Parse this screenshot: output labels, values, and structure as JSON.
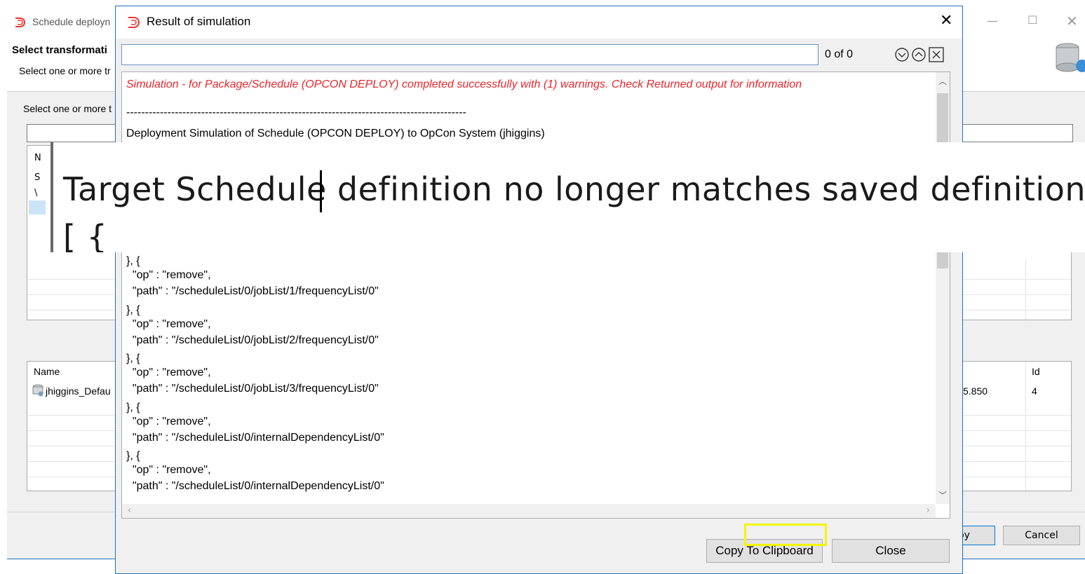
{
  "background_window": {
    "title": "Schedule deployn",
    "header_title": "Select transformati",
    "header_subtitle": "Select one or more tr",
    "group_label": "Select one or more t",
    "table1_fragments": [
      "N",
      "S",
      "\\"
    ],
    "table2": {
      "col_name": "Name",
      "col_id": "Id",
      "row_name": "jhiggins_Defau",
      "row_partial": "5.850",
      "row_id": "4"
    },
    "deploy_button": "oy",
    "cancel_button": "Cancel"
  },
  "dialog": {
    "title": "Result of simulation",
    "search_value": "",
    "match_count": "0 of 0",
    "copy_button": "Copy To Clipboard",
    "close_button": "Close",
    "output_lines": [
      {
        "text": "Simulation - for Package/Schedule (OPCON DEPLOY) completed successfully with (1) warnings. Check Returned output for information",
        "style": "warning"
      },
      {
        "text": "",
        "style": "normal"
      },
      {
        "text": "-------------------------------------------------------------------------------------------",
        "style": "normal"
      },
      {
        "text": "Deployment Simulation of Schedule (OPCON DEPLOY) to OpCon System (jhiggins)",
        "style": "normal"
      }
    ],
    "json_lines": [
      "}, {",
      "  \"op\" : \"remove\",",
      "  \"path\" : \"/scheduleList/0/jobList/1/frequencyList/0\"",
      "}, {",
      "  \"op\" : \"remove\",",
      "  \"path\" : \"/scheduleList/0/jobList/2/frequencyList/0\"",
      "}, {",
      "  \"op\" : \"remove\",",
      "  \"path\" : \"/scheduleList/0/jobList/3/frequencyList/0\"",
      "}, {",
      "  \"op\" : \"remove\",",
      "  \"path\" : \"/scheduleList/0/internalDependencyList/0\"",
      "}, {",
      "  \"op\" : \"remove\",",
      "  \"path\" : \"/scheduleList/0/internalDependencyList/0\""
    ]
  },
  "zoom_overlay": {
    "line1": "Target Schedule definition no longer matches saved definition",
    "line2": "[ {"
  },
  "colors": {
    "accent": "#1e73be",
    "warning_text": "#e8262a",
    "highlight": "#f5f500"
  }
}
